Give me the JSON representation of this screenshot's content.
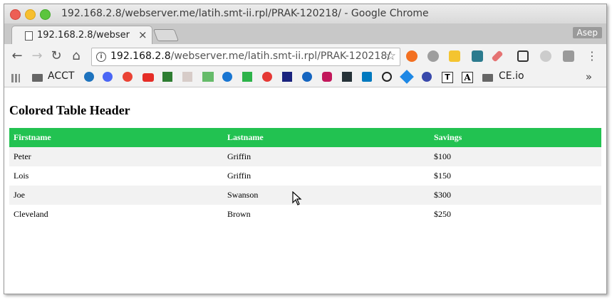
{
  "window": {
    "title": "192.168.2.8/webserver.me/latih.smt-ii.rpl/PRAK-120218/ - Google Chrome"
  },
  "tab": {
    "title": "192.168.2.8/webser"
  },
  "profile": "Asep",
  "address": {
    "host": "192.168.2.8",
    "path": "/webserver.me/latih.smt-ii.rpl/PRAK-120218/"
  },
  "bookmarks": {
    "first": "ACCT",
    "last": "CE.io",
    "overflow": "»"
  },
  "page": {
    "heading": "Colored Table Header"
  },
  "table": {
    "headers": [
      "Firstname",
      "Lastname",
      "Savings"
    ],
    "rows": [
      [
        "Peter",
        "Griffin",
        "$100"
      ],
      [
        "Lois",
        "Griffin",
        "$150"
      ],
      [
        "Joe",
        "Swanson",
        "$300"
      ],
      [
        "Cleveland",
        "Brown",
        "$250"
      ]
    ]
  },
  "colors": {
    "header_bg": "#22c251",
    "row_stripe": "#f2f2f2"
  }
}
